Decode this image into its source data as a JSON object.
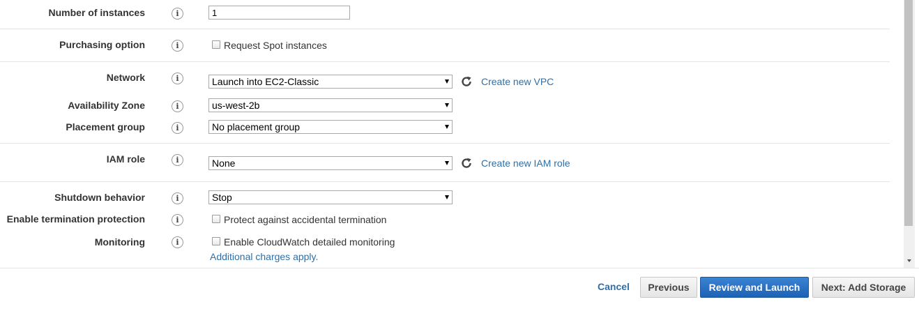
{
  "form": {
    "number_of_instances": {
      "label": "Number of instances",
      "value": "1"
    },
    "purchasing_option": {
      "label": "Purchasing option",
      "checkbox_label": "Request Spot instances"
    },
    "network": {
      "label": "Network",
      "selected": "Launch into EC2-Classic",
      "link": "Create new VPC"
    },
    "availability_zone": {
      "label": "Availability Zone",
      "selected": "us-west-2b"
    },
    "placement_group": {
      "label": "Placement group",
      "selected": "No placement group"
    },
    "iam_role": {
      "label": "IAM role",
      "selected": "None",
      "link": "Create new IAM role"
    },
    "shutdown_behavior": {
      "label": "Shutdown behavior",
      "selected": "Stop"
    },
    "termination_protection": {
      "label": "Enable termination protection",
      "checkbox_label": "Protect against accidental termination"
    },
    "monitoring": {
      "label": "Monitoring",
      "checkbox_label": "Enable CloudWatch detailed monitoring",
      "note_link": "Additional charges apply."
    },
    "info_glyph": "i"
  },
  "footer": {
    "cancel": "Cancel",
    "previous": "Previous",
    "review_and_launch": "Review and Launch",
    "next": "Next: Add Storage"
  },
  "icons": {
    "info": "info-icon",
    "refresh": "refresh-icon",
    "dropdown": "chevron-down-icon"
  },
  "colors": {
    "link": "#2e6fa7",
    "primary_button": "#2165bb"
  }
}
